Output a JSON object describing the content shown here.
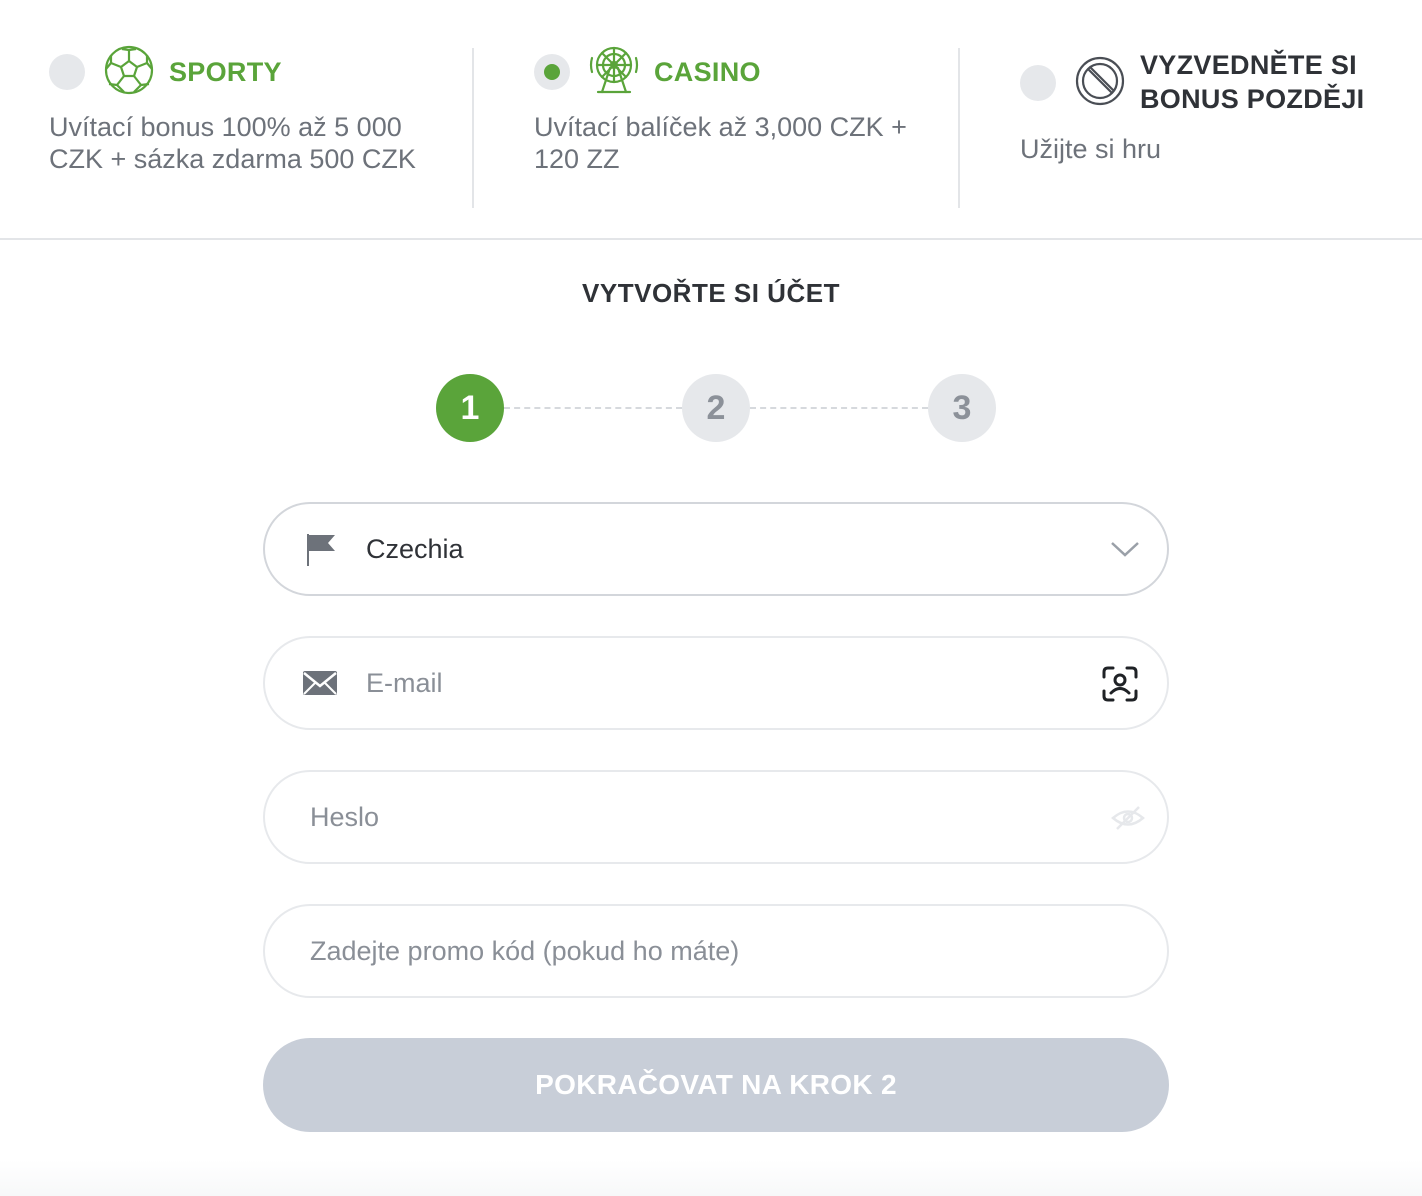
{
  "colors": {
    "accent_green": "#5aa43a",
    "radio_idle": "#e6e8eb",
    "submit_disabled": "#c8ced8"
  },
  "bonuses": [
    {
      "title": "SPORTY",
      "description": "Uvítací bonus 100% až 5 000 CZK + sázka zdarma 500 CZK",
      "icon": "soccer-ball-icon",
      "selected": false
    },
    {
      "title": "CASINO",
      "description": "Uvítací balíček až 3,000 CZK + 120 ZZ",
      "icon": "ferris-wheel-icon",
      "selected": true
    },
    {
      "title_line1": "VYZVEDNĚTE SI",
      "title_line2": "BONUS POZDĚJI",
      "description": "Užijte si hru",
      "icon": "no-entry-icon",
      "selected": false
    }
  ],
  "form": {
    "title": "VYTVOŘTE SI ÚČET",
    "steps": [
      "1",
      "2",
      "3"
    ],
    "active_step": 1,
    "country": {
      "value": "Czechia",
      "icon": "flag-icon",
      "chevron": "chevron-down-icon"
    },
    "email": {
      "placeholder": "E-mail",
      "icon": "envelope-icon",
      "action_icon": "face-id-icon"
    },
    "password": {
      "placeholder": "Heslo",
      "toggle_icon": "eye-slash-icon"
    },
    "promo": {
      "placeholder": "Zadejte promo kód (pokud ho máte)"
    },
    "submit_label": "POKRAČOVAT NA KROK 2"
  }
}
